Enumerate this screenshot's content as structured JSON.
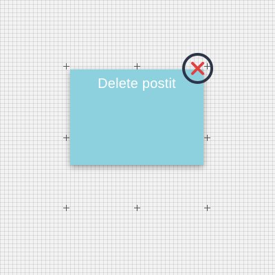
{
  "postit": {
    "label": "Delete postit",
    "color": "#8dd0de"
  },
  "delete_control": {
    "icon": "close-icon",
    "icon_color": "#e04040",
    "ring_color": "#2c3448"
  },
  "canvas": {
    "background": "#f3f3f3",
    "grid": true
  }
}
